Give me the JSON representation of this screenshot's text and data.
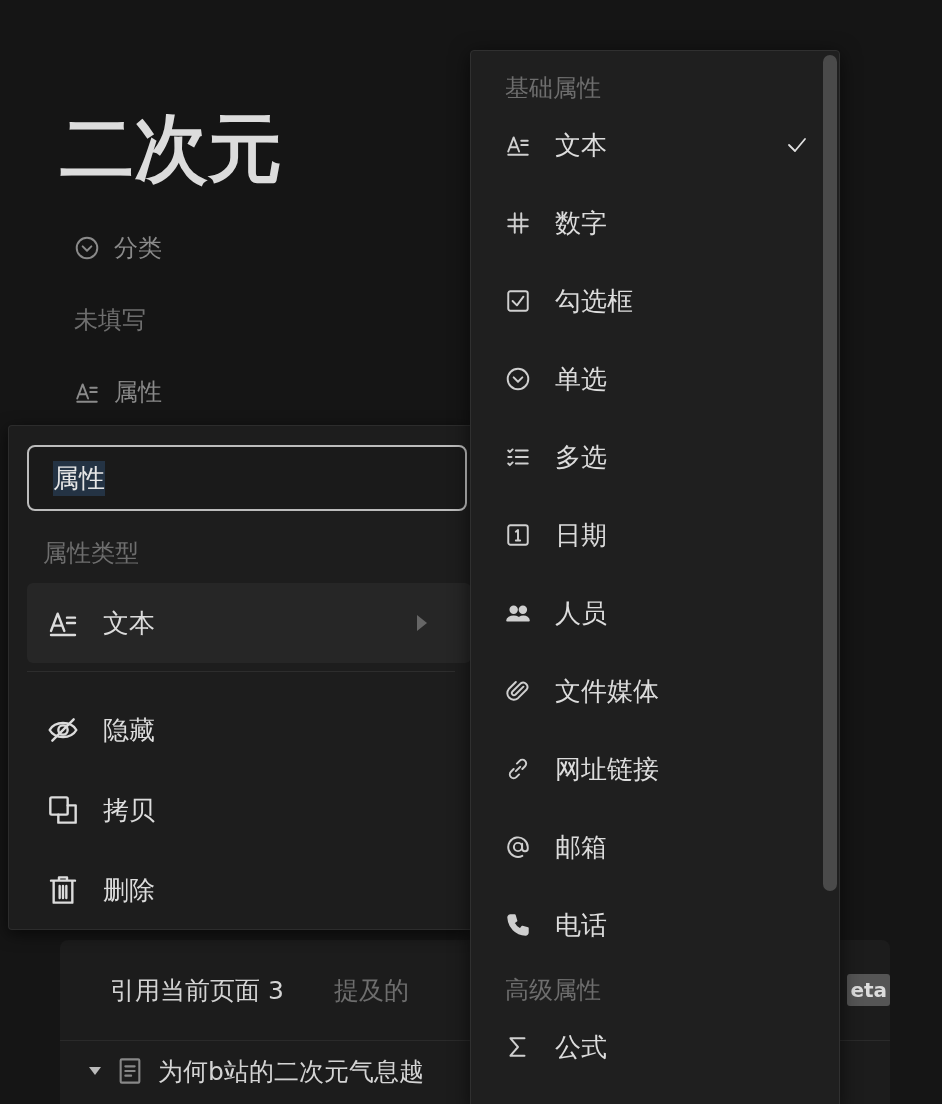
{
  "page": {
    "title": "二次元",
    "properties": [
      {
        "kind": "select",
        "name": "分类",
        "value": "未填写"
      },
      {
        "kind": "text",
        "name": "属性"
      }
    ]
  },
  "property_menu": {
    "name_field": {
      "value": "属性"
    },
    "type_label": "属性类型",
    "type_item": {
      "kind": "text",
      "label": "文本"
    },
    "actions": [
      {
        "kind": "hide",
        "label": "隐藏"
      },
      {
        "kind": "copy",
        "label": "拷贝"
      },
      {
        "kind": "delete",
        "label": "删除"
      }
    ]
  },
  "type_dropdown": {
    "sections": [
      {
        "title": "基础属性",
        "items": [
          {
            "kind": "text",
            "label": "文本",
            "selected": true
          },
          {
            "kind": "number",
            "label": "数字",
            "selected": false
          },
          {
            "kind": "checkbox",
            "label": "勾选框",
            "selected": false
          },
          {
            "kind": "select",
            "label": "单选",
            "selected": false
          },
          {
            "kind": "multiselect",
            "label": "多选",
            "selected": false
          },
          {
            "kind": "date",
            "label": "日期",
            "selected": false
          },
          {
            "kind": "person",
            "label": "人员",
            "selected": false
          },
          {
            "kind": "file",
            "label": "文件媒体",
            "selected": false
          },
          {
            "kind": "url",
            "label": "网址链接",
            "selected": false
          },
          {
            "kind": "email",
            "label": "邮箱",
            "selected": false
          },
          {
            "kind": "phone",
            "label": "电话",
            "selected": false
          }
        ]
      },
      {
        "title": "高级属性",
        "items": [
          {
            "kind": "formula",
            "label": "公式",
            "selected": false
          }
        ]
      }
    ]
  },
  "backlinks": {
    "tabs": [
      {
        "label": "引用当前页面 3",
        "selected": true
      },
      {
        "label": "提及的",
        "selected": false
      }
    ],
    "badge": "eta",
    "rows": [
      {
        "title": "为何b站的二次元气息越",
        "expanded": true
      }
    ]
  }
}
